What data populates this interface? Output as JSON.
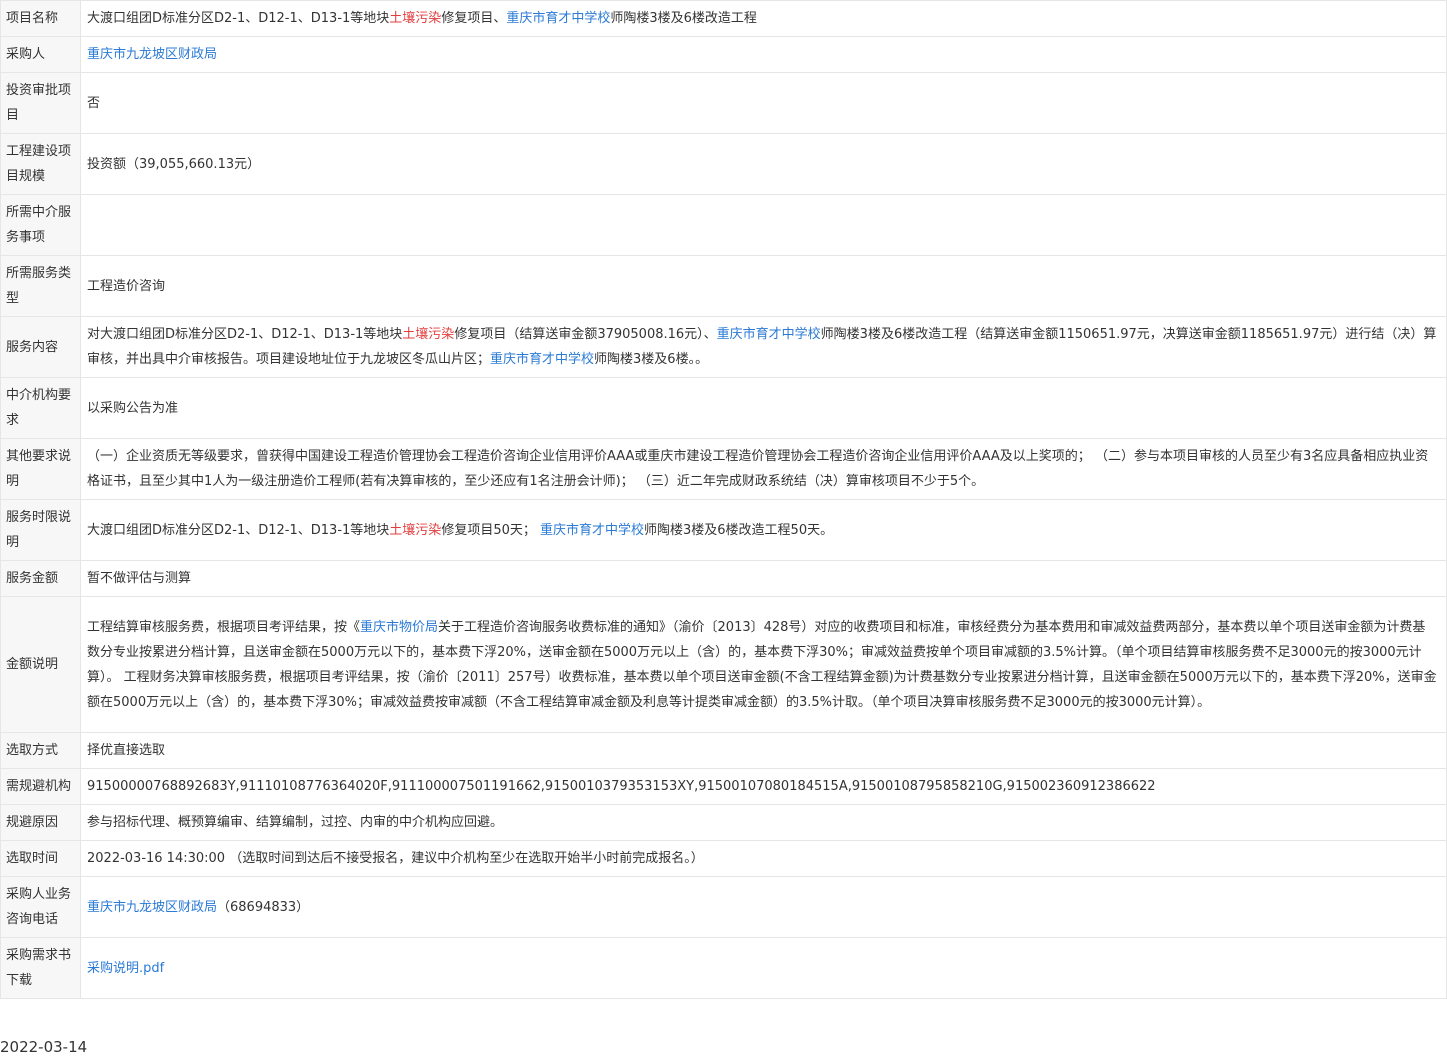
{
  "rows": {
    "project_name": {
      "label": "项目名称",
      "p1": "大渡口组团D标准分区D2-1、D12-1、D13-1等地块",
      "hl1": "土壤污染",
      "p2": "修复项目、",
      "link1": "重庆市育才中学校",
      "p3": "师陶楼3楼及6楼改造工程"
    },
    "purchaser": {
      "label": "采购人",
      "link": "重庆市九龙坡区财政局"
    },
    "investment_approval": {
      "label": "投资审批项目",
      "value": "否"
    },
    "scale": {
      "label": "工程建设项目规模",
      "value": "投资额（39,055,660.13元）"
    },
    "service_items": {
      "label": "所需中介服务事项",
      "value": ""
    },
    "service_type": {
      "label": "所需服务类型",
      "value": "工程造价咨询"
    },
    "service_content": {
      "label": "服务内容",
      "p1": "对大渡口组团D标准分区D2-1、D12-1、D13-1等地块",
      "hl1": "土壤污染",
      "p2": "修复项目（结算送审金额37905008.16元）、",
      "link1": "重庆市育才中学校",
      "p3": "师陶楼3楼及6楼改造工程（结算送审金额1150651.97元，决算送审金额1185651.97元）进行结（决）算审核，并出具中介审核报告。项目建设地址位于九龙坡区冬瓜山片区；",
      "link2": "重庆市育才中学校",
      "p4": "师陶楼3楼及6楼。。"
    },
    "agency_req": {
      "label": "中介机构要求",
      "value": "以采购公告为准"
    },
    "other_req": {
      "label": "其他要求说明",
      "value": "（一）企业资质无等级要求，曾获得中国建设工程造价管理协会工程造价咨询企业信用评价AAA或重庆市建设工程造价管理协会工程造价咨询企业信用评价AAA及以上奖项的；  （二）参与本项目审核的人员至少有3名应具备相应执业资格证书，且至少其中1人为一级注册造价工程师(若有决算审核的，至少还应有1名注册会计师)；  （三）近二年完成财政系统结（决）算审核项目不少于5个。"
    },
    "time_limit": {
      "label": "服务时限说明",
      "p1": "大渡口组团D标准分区D2-1、D12-1、D13-1等地块",
      "hl1": "土壤污染",
      "p2": "修复项目50天；  ",
      "link1": "重庆市育才中学校",
      "p3": "师陶楼3楼及6楼改造工程50天。"
    },
    "amount": {
      "label": "服务金额",
      "value": "暂不做评估与测算"
    },
    "amount_desc": {
      "label": "金额说明",
      "p1": "工程结算审核服务费，根据项目考评结果，按《",
      "link1": "重庆市物价局",
      "p2": "关于工程造价咨询服务收费标准的通知》（渝价〔2013〕428号）对应的收费项目和标准，审核经费分为基本费用和审减效益费两部分，基本费以单个项目送审金额为计费基数分专业按累进分档计算，且送审金额在5000万元以下的，基本费下浮20%，送审金额在5000万元以上（含）的，基本费下浮30%；审减效益费按单个项目审减额的3.5%计算。（单个项目结算审核服务费不足3000元的按3000元计算）。 工程财务决算审核服务费，根据项目考评结果，按（渝价〔2011〕257号）收费标准，基本费以单个项目送审金额(不含工程结算金额)为计费基数分专业按累进分档计算，且送审金额在5000万元以下的，基本费下浮20%，送审金额在5000万元以上（含）的，基本费下浮30%；审减效益费按审减额（不含工程结算审减金额及利息等计提类审减金额）的3.5%计取。（单个项目决算审核服务费不足3000元的按3000元计算）。"
    },
    "selection_method": {
      "label": "选取方式",
      "value": "择优直接选取"
    },
    "avoid_agencies": {
      "label": "需规避机构",
      "value": "91500000768892683Y,91110108776364020F,911100007501191662,9150010379353153XY,91500107080184515A,91500108795858210G,915002360912386622"
    },
    "avoid_reason": {
      "label": "规避原因",
      "value": "参与招标代理、概预算编审、结算编制，过控、内审的中介机构应回避。"
    },
    "selection_time": {
      "label": "选取时间",
      "value": "2022-03-16 14:30:00 （选取时间到达后不接受报名，建议中介机构至少在选取开始半小时前完成报名。）"
    },
    "consult_phone": {
      "label": "采购人业务咨询电话",
      "link": "重庆市九龙坡区财政局",
      "phone": "（68694833）"
    },
    "download": {
      "label": "采购需求书下载",
      "link": "采购说明.pdf"
    }
  },
  "footer_date": "2022-03-14",
  "colors": {
    "link": "#2a7ad6",
    "highlight": "#e23c3c",
    "label_bg": "#f7f7f7",
    "border": "#e6e6e6",
    "text": "#333333"
  }
}
